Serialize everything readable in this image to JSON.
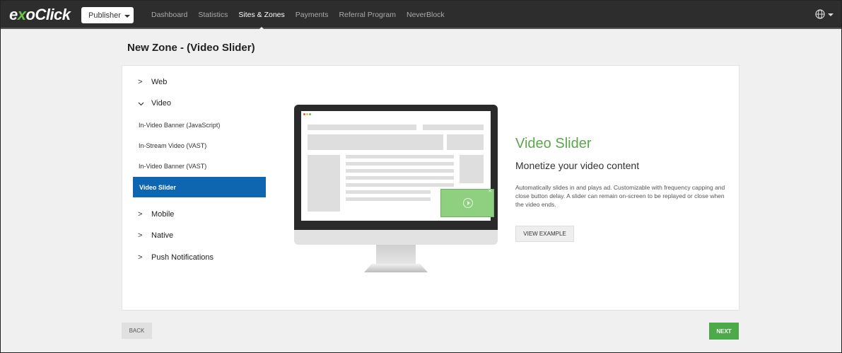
{
  "header": {
    "logo_prefix": "e",
    "logo_x": "x",
    "logo_suffix": "oClick",
    "publisher_label": "Publisher",
    "nav": [
      {
        "label": "Dashboard"
      },
      {
        "label": "Statistics"
      },
      {
        "label": "Sites & Zones"
      },
      {
        "label": "Payments"
      },
      {
        "label": "Referral Program"
      },
      {
        "label": "NeverBlock"
      }
    ],
    "active_nav": "Sites & Zones",
    "language_icon": "globe-icon"
  },
  "page": {
    "title": "New Zone - (Video Slider)"
  },
  "menu": {
    "categories": [
      {
        "label": "Web",
        "expanded": false
      },
      {
        "label": "Video",
        "expanded": true
      },
      {
        "label": "Mobile",
        "expanded": false
      },
      {
        "label": "Native",
        "expanded": false
      },
      {
        "label": "Push Notifications",
        "expanded": false
      }
    ],
    "video_items": [
      {
        "label": "In-Video Banner (JavaScript)"
      },
      {
        "label": "In-Stream Video (VAST)"
      },
      {
        "label": "In-Video Banner (VAST)"
      },
      {
        "label": "Video Slider"
      }
    ],
    "selected": "Video Slider"
  },
  "detail": {
    "title": "Video Slider",
    "subtitle": "Monetize your video content",
    "description": "Automatically slides in and plays ad. Customizable with frequency capping and close button delay. A slider can remain on-screen to be replayed or close when the video ends.",
    "view_example_label": "VIEW EXAMPLE"
  },
  "footer": {
    "back_label": "BACK",
    "next_label": "NEXT"
  },
  "colors": {
    "accent_green": "#5aa84a",
    "selected_blue": "#0f66b0",
    "topbar": "#2d2d2d"
  }
}
